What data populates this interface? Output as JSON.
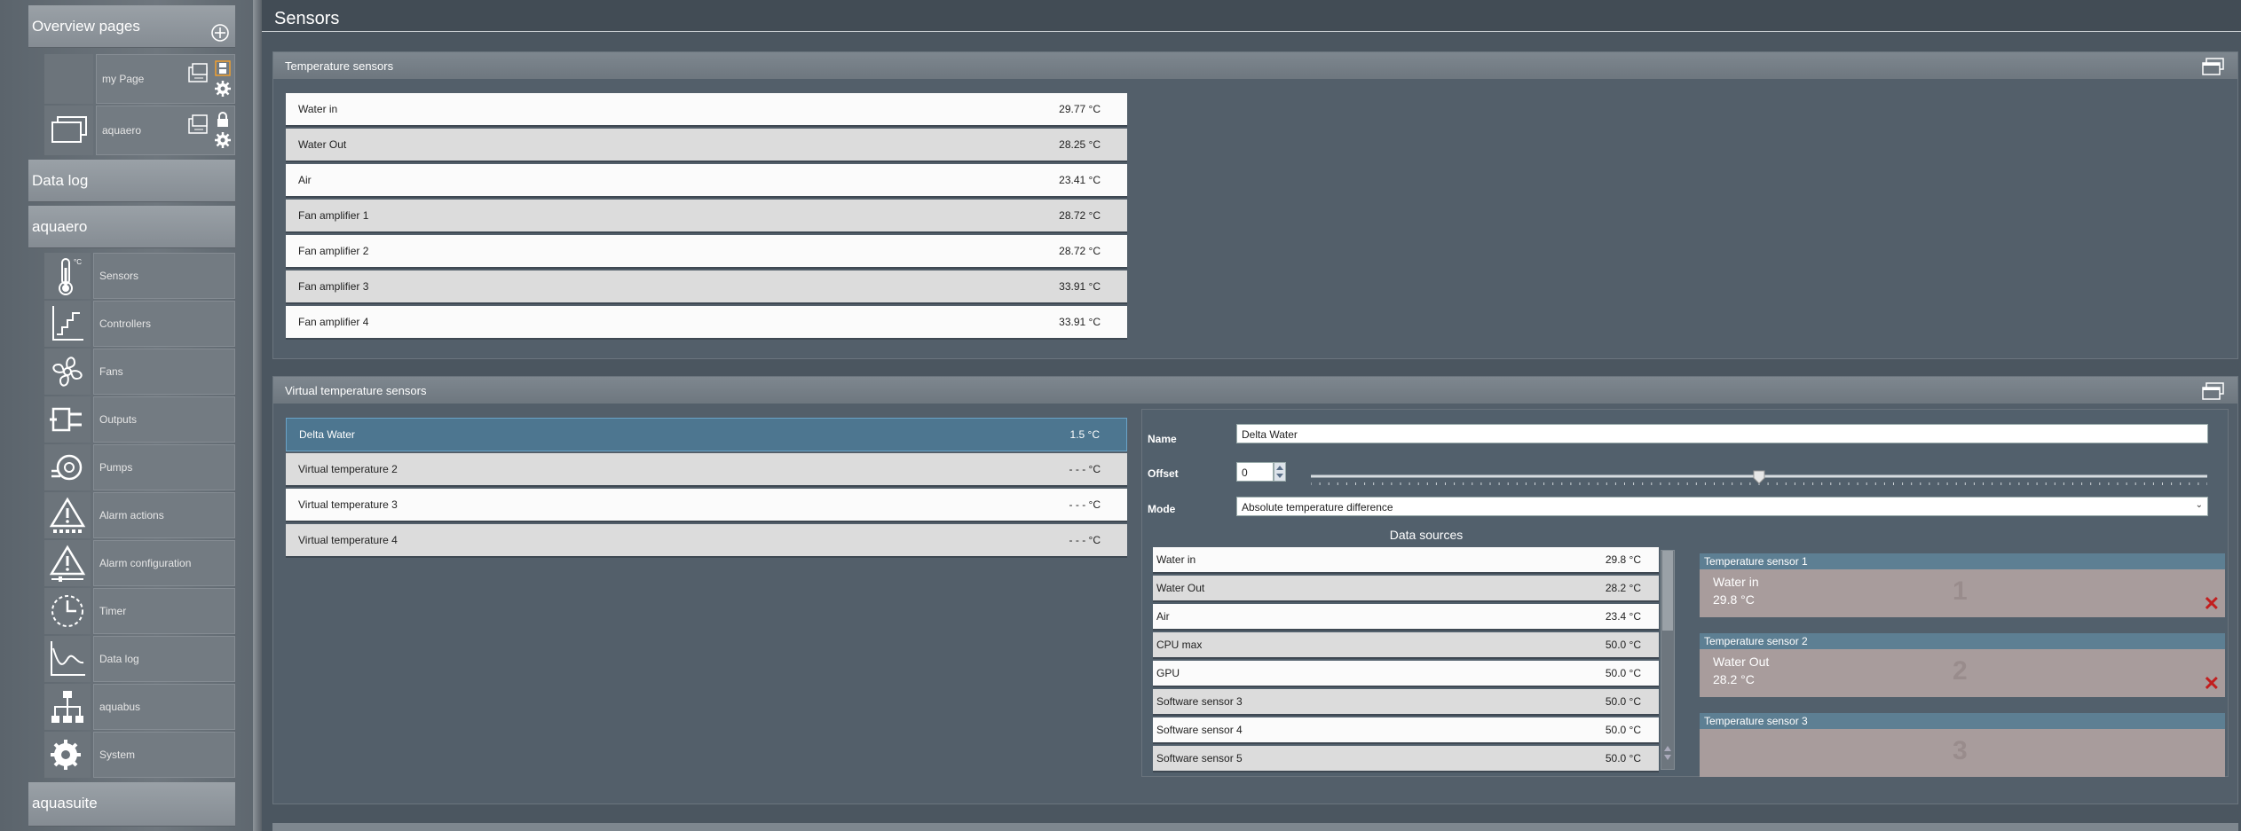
{
  "sidebar": {
    "overview_header": "Overview pages",
    "overview_pages": [
      {
        "label": "my Page"
      },
      {
        "label": "aquaero"
      }
    ],
    "datalog_header": "Data log",
    "aquaero_header": "aquaero",
    "items": [
      {
        "label": "Sensors",
        "icon": "thermometer-icon"
      },
      {
        "label": "Controllers",
        "icon": "controller-icon"
      },
      {
        "label": "Fans",
        "icon": "fan-icon"
      },
      {
        "label": "Outputs",
        "icon": "plug-icon"
      },
      {
        "label": "Pumps",
        "icon": "pump-icon"
      },
      {
        "label": "Alarm actions",
        "icon": "warning-icon"
      },
      {
        "label": "Alarm configuration",
        "icon": "warning-config-icon"
      },
      {
        "label": "Timer",
        "icon": "clock-icon"
      },
      {
        "label": "Data log",
        "icon": "chart-icon"
      },
      {
        "label": "aquabus",
        "icon": "network-icon"
      },
      {
        "label": "System",
        "icon": "gear-icon"
      }
    ],
    "aquasuite_header": "aquasuite"
  },
  "main": {
    "title": "Sensors",
    "temperature_panel": {
      "title": "Temperature sensors",
      "rows": [
        {
          "name": "Water in",
          "value": "29.77 °C"
        },
        {
          "name": "Water Out",
          "value": "28.25 °C"
        },
        {
          "name": "Air",
          "value": "23.41 °C"
        },
        {
          "name": "Fan amplifier 1",
          "value": "28.72 °C"
        },
        {
          "name": "Fan amplifier 2",
          "value": "28.72 °C"
        },
        {
          "name": "Fan amplifier 3",
          "value": "33.91 °C"
        },
        {
          "name": "Fan amplifier 4",
          "value": "33.91 °C"
        }
      ]
    },
    "virtual_panel": {
      "title": "Virtual temperature sensors",
      "rows": [
        {
          "name": "Delta Water",
          "value": "1.5 °C"
        },
        {
          "name": "Virtual temperature 2",
          "value": "- - - °C"
        },
        {
          "name": "Virtual temperature 3",
          "value": "- - - °C"
        },
        {
          "name": "Virtual temperature 4",
          "value": "- - - °C"
        }
      ],
      "editor": {
        "name_label": "Name",
        "name_value": "Delta Water",
        "offset_label": "Offset",
        "offset_value": "0",
        "offset_slider_level": 0.5,
        "mode_label": "Mode",
        "mode_value": "Absolute temperature difference",
        "data_sources_title": "Data sources",
        "data_sources": [
          {
            "name": "Water in",
            "value": "29.8 °C"
          },
          {
            "name": "Water Out",
            "value": "28.2 °C"
          },
          {
            "name": "Air",
            "value": "23.4 °C"
          },
          {
            "name": "CPU max",
            "value": "50.0 °C"
          },
          {
            "name": "GPU",
            "value": "50.0 °C"
          },
          {
            "name": "Software sensor 3",
            "value": "50.0 °C"
          },
          {
            "name": "Software sensor 4",
            "value": "50.0 °C"
          },
          {
            "name": "Software sensor 5",
            "value": "50.0 °C"
          }
        ],
        "selected_sources": [
          {
            "header": "Temperature sensor 1",
            "name": "Water in",
            "value": "29.8 °C",
            "number": "1"
          },
          {
            "header": "Temperature sensor 2",
            "name": "Water Out",
            "value": "28.2 °C",
            "number": "2"
          },
          {
            "header": "Temperature sensor 3",
            "name": "",
            "value": "",
            "number": "3"
          }
        ]
      }
    }
  }
}
